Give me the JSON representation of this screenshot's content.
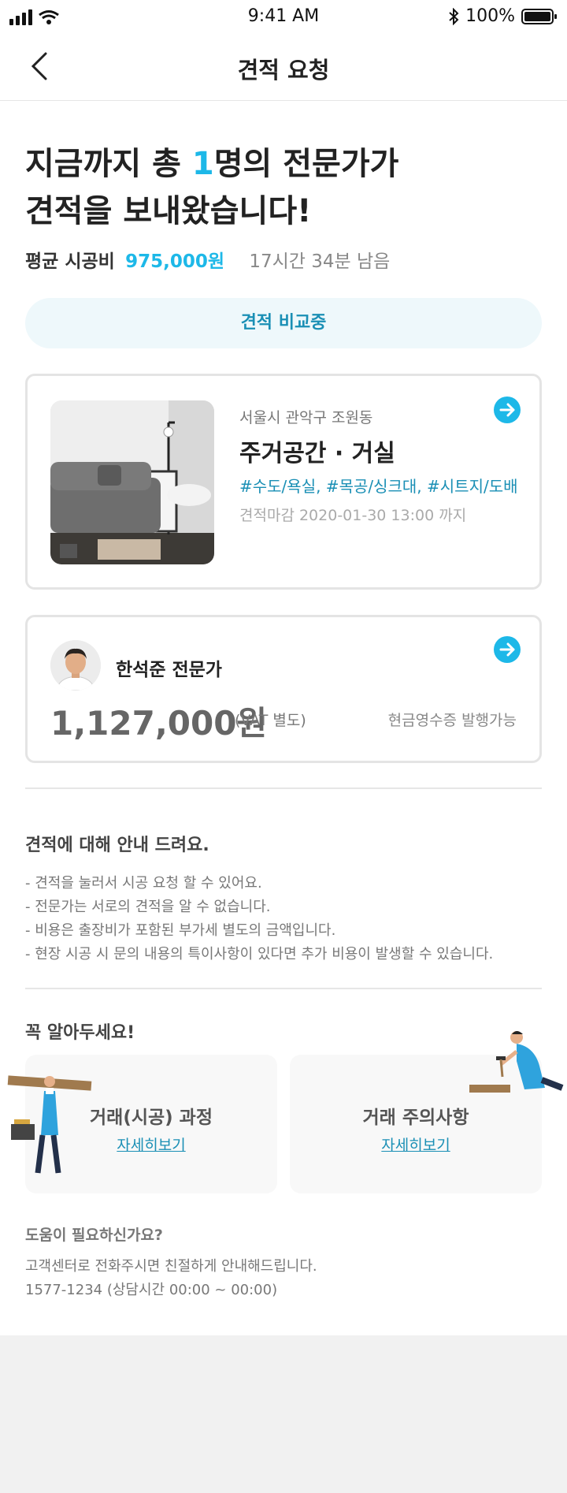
{
  "status_bar": {
    "time": "9:41 AM",
    "battery": "100%"
  },
  "nav": {
    "title": "견적 요청"
  },
  "headline": {
    "line1_prefix": "지금까지 총 ",
    "count": "1",
    "line1_suffix": "명의 전문가가",
    "line2": "견적을 보내왔습니다!"
  },
  "summary": {
    "avg_label": "평균 시공비",
    "avg_price": "975,000원",
    "remaining": "17시간 34분 남음"
  },
  "compare_button": "견적 비교중",
  "request_card": {
    "address": "서울시 관악구 조원동",
    "space": "주거공간 · 거실",
    "tags": "#수도/욕실, #목공/싱크대, #시트지/도배",
    "deadline": "견적마감 2020-01-30 13:00 까지"
  },
  "expert_card": {
    "name": "한석준 전문가",
    "amount": "1,127,000원",
    "vat": "(VAT 별도)",
    "receipt": "현금영수증 발행가능"
  },
  "guide": {
    "title": "견적에 대해 안내 드려요.",
    "items": [
      "- 견적을 눌러서 시공 요청 할 수 있어요.",
      "- 전문가는 서로의 견적을 알 수 없습니다.",
      "- 비용은 출장비가 포함된 부가세 별도의 금액입니다.",
      "- 현장 시공 시 문의 내용의 특이사항이 있다면 추가 비용이 발생할 수 있습니다."
    ]
  },
  "must_know": {
    "title": "꼭 알아두세요!",
    "boxes": [
      {
        "title": "거래(시공) 과정",
        "link": "자세히보기"
      },
      {
        "title": "거래 주의사항",
        "link": "자세히보기"
      }
    ]
  },
  "help": {
    "title": "도움이 필요하신가요?",
    "desc": "고객센터로 전화주시면 친절하게 안내해드립니다.",
    "phone": "1577-1234 (상담시간 00:00 ~ 00:00)"
  },
  "colors": {
    "accent": "#1db8e8",
    "link": "#1a8fb5",
    "compare_bg": "#eef8fb"
  },
  "icons": [
    "signal-icon",
    "wifi-icon",
    "bluetooth-icon",
    "battery-icon",
    "back-arrow-icon",
    "arrow-right-circle-icon"
  ]
}
